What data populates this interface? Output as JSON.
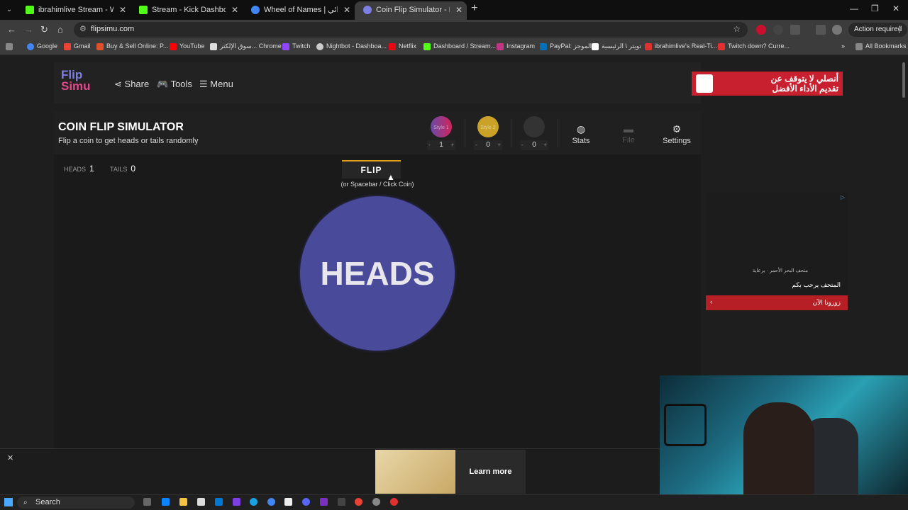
{
  "browser": {
    "tabs": [
      {
        "title": "ibrahimlive Stream - Watch Live",
        "color": "#53fc18"
      },
      {
        "title": "Stream - Kick Dashboard",
        "color": "#53fc18"
      },
      {
        "title": "Wheel of Names | عجلة الأسماء العشوائي",
        "color": "#4285f4"
      },
      {
        "title": "Coin Flip Simulator - Flip a Coin",
        "color": "#7d7ee6"
      }
    ],
    "url": "flipsimu.com",
    "action_required": "Action required",
    "bookmarks": [
      {
        "label": "Google",
        "color": "#4285f4"
      },
      {
        "label": "Gmail",
        "color": "#ea4335"
      },
      {
        "label": "Buy & Sell Online: P...",
        "color": "#e0502a"
      },
      {
        "label": "YouTube",
        "color": "#ff0000"
      },
      {
        "label": "سوق الإلكتر... Chrome",
        "color": "#dddddd"
      },
      {
        "label": "Twitch",
        "color": "#9146ff"
      },
      {
        "label": "Nightbot - Dashboa...",
        "color": "#cccccc"
      },
      {
        "label": "Netflix",
        "color": "#e50914"
      },
      {
        "label": "Dashboard / Stream...",
        "color": "#53fc18"
      },
      {
        "label": "Instagram",
        "color": "#c13584"
      },
      {
        "label": "PayPal: الموجز",
        "color": "#0070ba"
      },
      {
        "label": "تويتر \\ الرئيسية",
        "color": "#ffffff"
      },
      {
        "label": "ibrahimlive's Real-Ti...",
        "color": "#e03030"
      },
      {
        "label": "Twitch down? Curre...",
        "color": "#e03030"
      }
    ],
    "all_bookmarks": "All Bookmarks"
  },
  "site": {
    "logo_line1": "Flip",
    "logo_line2": "Simu",
    "nav": {
      "share": "Share",
      "tools": "Tools",
      "menu": "Menu"
    },
    "top_ad_text": "أنصلي لا يتوقف عن\nتقديم الأداء الأفضل"
  },
  "simulator": {
    "title": "COIN FLIP SIMULATOR",
    "subtitle": "Flip a coin to get heads or tails randomly",
    "styles": [
      {
        "label": "Style 1",
        "count": "1",
        "color": "#8a3a9a"
      },
      {
        "label": "Style 2",
        "count": "0",
        "color": "#c9a227"
      },
      {
        "label": "",
        "count": "0",
        "color": "#3a3a3a"
      }
    ],
    "toolbar": {
      "stats": "Stats",
      "file": "File",
      "settings": "Settings"
    },
    "score": {
      "heads_label": "HEADS",
      "heads": "1",
      "tails_label": "TAILS",
      "tails": "0"
    },
    "flip_label": "FLIP",
    "flip_hint": "(or Spacebar / Click Coin)",
    "result": "HEADS",
    "coin_color": "#4a4a9b"
  },
  "side_ad": {
    "line1": "متحف البحر الأحمر · برعاية",
    "line2": "المتحف يرحب بكم",
    "cta": "زورونا الآن"
  },
  "bottom_ad": {
    "learn_more": "Learn more"
  },
  "taskbar": {
    "search": "Search"
  }
}
